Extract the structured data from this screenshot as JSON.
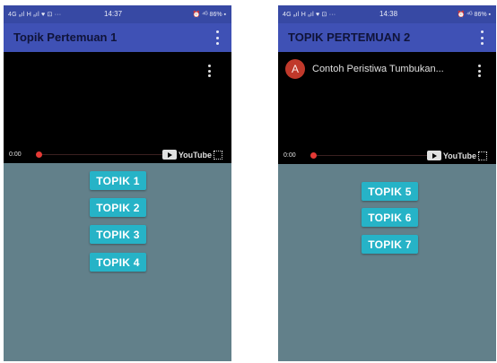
{
  "screens": [
    {
      "status": {
        "left": "4G ₐıl H ₐıl ♥ ⊡ ···",
        "time": "14:37",
        "right": "⏰ ⁴ᴳ 86% ▪"
      },
      "appbar": {
        "title": "Topik Pertemuan 1"
      },
      "video": {
        "time": "0:00",
        "channel_initial": "",
        "title": "",
        "logo": "YouTube"
      },
      "buttons": [
        "TOPIK 1",
        "TOPIK 2",
        "TOPIK 3",
        "TOPIK 4"
      ]
    },
    {
      "status": {
        "left": "4G ₐıl H ₐıl ♥ ⊡ ···",
        "time": "14:38",
        "right": "⏰ ⁴ᴳ 86% ▪"
      },
      "appbar": {
        "title": "TOPIK PERTEMUAN 2"
      },
      "video": {
        "time": "0:00",
        "channel_initial": "A",
        "title": "Contoh Peristiwa Tumbukan...",
        "logo": "YouTube"
      },
      "buttons": [
        "TOPIK 5",
        "TOPIK 6",
        "TOPIK 7"
      ]
    }
  ],
  "colors": {
    "appbar": "#3f51b5",
    "statusbar": "#3749a4",
    "content": "#62808a",
    "button": "#26b3c7",
    "progress": "#e53935"
  },
  "icons": [
    "overflow-menu-icon",
    "youtube-logo-icon",
    "fullscreen-icon",
    "play-icon"
  ]
}
